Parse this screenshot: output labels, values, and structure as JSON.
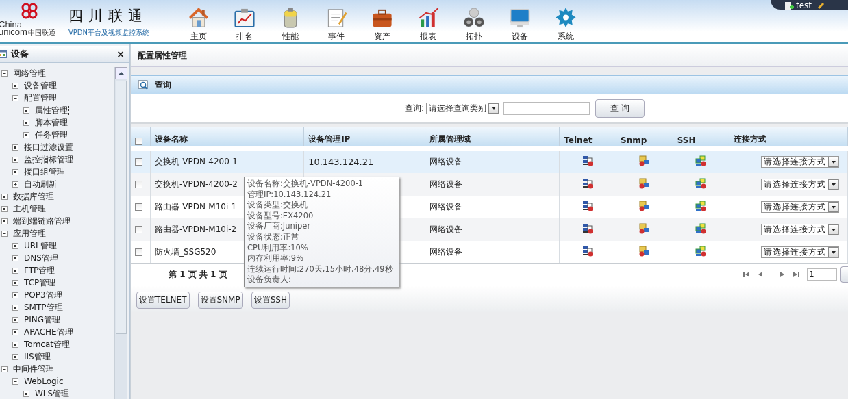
{
  "header": {
    "logo": {
      "line1": "China",
      "line2": "unicom",
      "cn": "中国联通"
    },
    "title": "四川联通",
    "subtitle": "VPDN平台及视频监控系统",
    "user": "test"
  },
  "nav": [
    {
      "label": "主页",
      "kind": "home"
    },
    {
      "label": "排名",
      "kind": "ranking"
    },
    {
      "label": "性能",
      "kind": "performance"
    },
    {
      "label": "事件",
      "kind": "event"
    },
    {
      "label": "资产",
      "kind": "asset"
    },
    {
      "label": "报表",
      "kind": "report"
    },
    {
      "label": "拓扑",
      "kind": "topology"
    },
    {
      "label": "设备",
      "kind": "device"
    },
    {
      "label": "系统",
      "kind": "system"
    }
  ],
  "sidebar": {
    "title": "设备",
    "close": "×",
    "tree": [
      {
        "label": "网络管理",
        "expanded": true,
        "selected": false,
        "children": [
          {
            "label": "设备管理",
            "selected": false
          },
          {
            "label": "配置管理",
            "expanded": true,
            "selected": false,
            "children": [
              {
                "label": "属性管理",
                "selected": true
              },
              {
                "label": "脚本管理",
                "selected": false
              },
              {
                "label": "任务管理",
                "selected": false
              }
            ]
          },
          {
            "label": "接口过滤设置",
            "selected": false
          },
          {
            "label": "监控指标管理",
            "selected": false
          },
          {
            "label": "接口组管理",
            "selected": false
          },
          {
            "label": "自动刷新",
            "expanded": false,
            "selected": false
          }
        ]
      },
      {
        "label": "数据库管理",
        "selected": false
      },
      {
        "label": "主机管理",
        "selected": false
      },
      {
        "label": "端到端链路管理",
        "selected": false
      },
      {
        "label": "应用管理",
        "expanded": true,
        "selected": false,
        "children": [
          {
            "label": "URL管理",
            "selected": false
          },
          {
            "label": "DNS管理",
            "selected": false
          },
          {
            "label": "FTP管理",
            "selected": false
          },
          {
            "label": "TCP管理",
            "selected": false
          },
          {
            "label": "POP3管理",
            "selected": false
          },
          {
            "label": "SMTP管理",
            "selected": false
          },
          {
            "label": "PING管理",
            "selected": false
          },
          {
            "label": "APACHE管理",
            "selected": false
          },
          {
            "label": "Tomcat管理",
            "selected": false
          },
          {
            "label": "IIS管理",
            "selected": false
          }
        ]
      },
      {
        "label": "中间件管理",
        "expanded": true,
        "selected": false,
        "children": [
          {
            "label": "WebLogic",
            "expanded": true,
            "selected": false,
            "children": [
              {
                "label": "WLS管理",
                "selected": false
              }
            ]
          }
        ]
      }
    ]
  },
  "main": {
    "title": "配置属性管理",
    "query": {
      "title": "查询",
      "label": "查询:",
      "select": "请选择查询类别",
      "button": "查 询"
    },
    "table": {
      "all_checked": false,
      "columns": [
        "设备名称",
        "设备管理IP",
        "所属管理域",
        "Telnet",
        "Snmp",
        "SSH",
        "连接方式"
      ],
      "rows": [
        {
          "name": "交换机-VPDN-4200-1",
          "ip": "10.143.124.21",
          "domain": "网络设备",
          "checked": false,
          "selected": true,
          "connect": "请选择连接方式"
        },
        {
          "name": "交换机-VPDN-4200-2",
          "domain": "网络设备",
          "checked": false,
          "selected": false,
          "connect": "请选择连接方式"
        },
        {
          "name": "路由器-VPDN-M10i-1",
          "domain": "网络设备",
          "checked": false,
          "selected": false,
          "connect": "请选择连接方式"
        },
        {
          "name": "路由器-VPDN-M10i-2",
          "domain": "网络设备",
          "checked": false,
          "selected": false,
          "connect": "请选择连接方式"
        },
        {
          "name": "防火墙_SSG520",
          "domain": "网络设备",
          "checked": false,
          "selected": false,
          "connect": "请选择连接方式"
        }
      ]
    },
    "pagination": {
      "text": "第 1 页 共 1 页",
      "page": "1"
    },
    "buttons": [
      "设置TELNET",
      "设置SNMP",
      "设置SSH"
    ],
    "tooltip": [
      "设备名称:交换机-VPDN-4200-1",
      "管理IP:10.143.124.21",
      "设备类型:交换机",
      "设备型号:EX4200",
      "设备厂商:Juniper",
      "设备状态:正常",
      "CPU利用率:10%",
      "内存利用率:9%",
      "连续运行时间:270天,15小时,48分,49秒",
      "设备负责人:"
    ]
  }
}
